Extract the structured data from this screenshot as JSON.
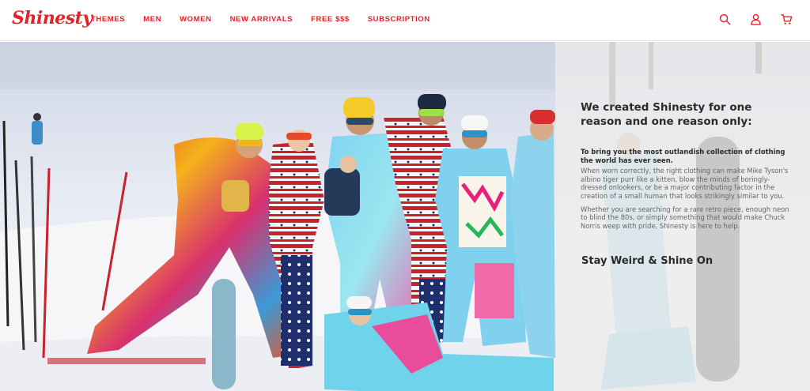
{
  "header": {
    "logo": "Shinesty",
    "nav": [
      "THEMES",
      "MEN",
      "WOMEN",
      "NEW ARRIVALS",
      "FREE $$$",
      "SUBSCRIPTION"
    ],
    "icons": [
      "search-icon",
      "account-icon",
      "cart-icon"
    ],
    "accent_color": "#e8202a"
  },
  "hero": {
    "heading": "We created Shinesty for one reason and one reason only:",
    "lead": "To bring you the most outlandish collection of clothing the world has ever seen.",
    "body1": "When worn correctly, the right clothing can make Mike Tyson's albino tiger purr like a kitten, blow the minds of boringly-dressed onlookers, or be a major contributing factor in the creation of a small human that looks strikingly similar to you.",
    "body2": "Whether you are searching for a rare retro piece, enough neon to blind the 80s, or simply something that would make Chuck Norris weep with pride, Shinesty is here to help.",
    "tagline": "Stay Weird & Shine On"
  }
}
